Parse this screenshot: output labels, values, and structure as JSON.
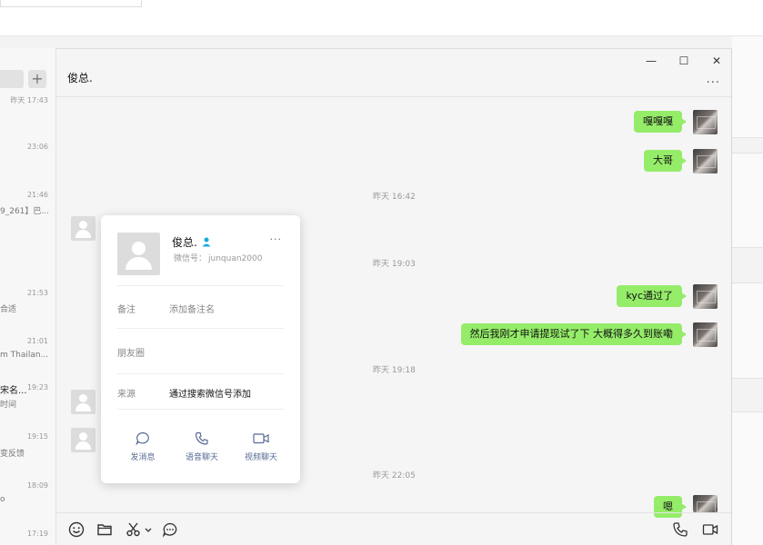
{
  "chat_list": {
    "add_label": "+",
    "items": [
      {
        "time": "昨天 17:43"
      },
      {
        "time": "23:06"
      },
      {
        "time": "21:46",
        "preview": "9_261】巴..."
      },
      {
        "time": "21:53",
        "preview": "合适"
      },
      {
        "time": "21:01",
        "preview": "m Thailan..."
      },
      {
        "time": "19:23",
        "name": "宋名...",
        "preview": "时间"
      },
      {
        "time": "19:15",
        "preview": "变反馈"
      },
      {
        "time": "18:09",
        "preview": "o"
      },
      {
        "time": "17:19"
      }
    ]
  },
  "chat": {
    "title": "俊总.",
    "more_label": "···",
    "window_controls": {
      "minimize": "—",
      "maximize": "☐",
      "close": "✕"
    },
    "messages": {
      "m1": "嘎嘎嘎",
      "m2": "大哥",
      "ts1": "昨天 16:42",
      "ts2": "昨天 19:03",
      "m3": "kyc通过了",
      "m4": "然后我刚才申请提现试了下 大概得多久到账嘞",
      "ts3": "昨天 19:18",
      "ts4": "昨天 22:05",
      "m5": "嗯"
    }
  },
  "profile": {
    "name": "俊总.",
    "more": "···",
    "wxid_label": "微信号：",
    "wxid": "junquan2000",
    "remark_label": "备注",
    "remark_placeholder": "添加备注名",
    "moments_label": "朋友圈",
    "source_label": "来源",
    "source_value": "通过搜索微信号添加",
    "actions": {
      "message": "发消息",
      "voice": "语音聊天",
      "video": "视频聊天"
    }
  },
  "colors": {
    "bubble": "#95ec69",
    "link": "#576b95",
    "gender_male": "#1aabd9"
  }
}
